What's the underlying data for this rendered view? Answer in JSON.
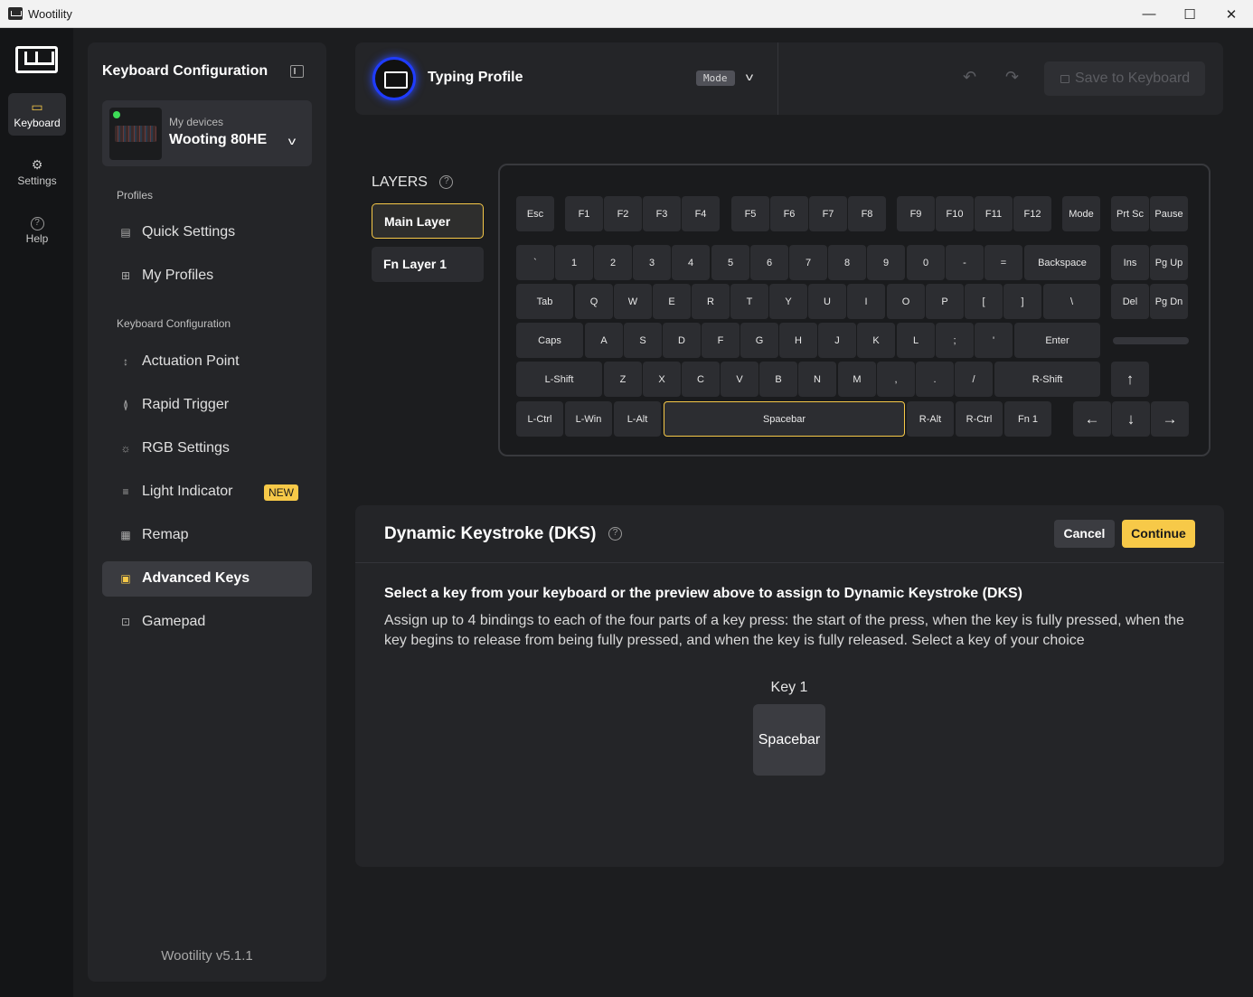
{
  "window": {
    "title": "Wootility",
    "minimize": "—",
    "maximize": "☐",
    "close": "✕"
  },
  "rail": {
    "items": [
      {
        "label": "Keyboard",
        "icon": "keyboard-icon"
      },
      {
        "label": "Settings",
        "icon": "gear-icon"
      },
      {
        "label": "Help",
        "icon": "help-icon"
      }
    ]
  },
  "sidebar": {
    "title": "Keyboard Configuration",
    "device": {
      "label": "My devices",
      "name": "Wooting 80HE",
      "status_color": "#3ddc57"
    },
    "profiles_label": "Profiles",
    "profile_items": [
      "Quick Settings",
      "My Profiles"
    ],
    "config_label": "Keyboard Configuration",
    "config_items": [
      "Actuation Point",
      "Rapid Trigger",
      "RGB Settings",
      "Light Indicator",
      "Remap",
      "Advanced Keys",
      "Gamepad"
    ],
    "new_badge": "NEW",
    "version": "Wootility v5.1.1"
  },
  "topbar": {
    "profile_name": "Typing Profile",
    "mode_badge": "Mode",
    "save_label": "Save to Keyboard"
  },
  "layers": {
    "title": "LAYERS",
    "items": [
      "Main Layer",
      "Fn Layer 1"
    ]
  },
  "keyboard": {
    "rows": [
      [
        "Esc",
        "F1",
        "F2",
        "F3",
        "F4",
        "F5",
        "F6",
        "F7",
        "F8",
        "F9",
        "F10",
        "F11",
        "F12",
        "Mode",
        "Prt Sc",
        "Pause"
      ],
      [
        "`",
        "1",
        "2",
        "3",
        "4",
        "5",
        "6",
        "7",
        "8",
        "9",
        "0",
        "-",
        "=",
        "Backspace",
        "Ins",
        "Pg Up"
      ],
      [
        "Tab",
        "Q",
        "W",
        "E",
        "R",
        "T",
        "Y",
        "U",
        "I",
        "O",
        "P",
        "[",
        "]",
        "\\",
        "Del",
        "Pg Dn"
      ],
      [
        "Caps",
        "A",
        "S",
        "D",
        "F",
        "G",
        "H",
        "J",
        "K",
        "L",
        ";",
        "'",
        "Enter"
      ],
      [
        "L-Shift",
        "Z",
        "X",
        "C",
        "V",
        "B",
        "N",
        "M",
        ",",
        ".",
        "/",
        "R-Shift",
        "↑"
      ],
      [
        "L-Ctrl",
        "L-Win",
        "L-Alt",
        "Spacebar",
        "R-Alt",
        "R-Ctrl",
        "Fn 1",
        "←",
        "↓",
        "→"
      ]
    ],
    "selected_key": "Spacebar"
  },
  "dks": {
    "title": "Dynamic Keystroke (DKS)",
    "cancel": "Cancel",
    "continue": "Continue",
    "instruction": "Select a key from your keyboard or the preview above to assign to Dynamic Keystroke (DKS)",
    "description": "Assign up to 4 bindings to each of the four parts of a key press: the start of the press, when the key is fully pressed, when the key begins to release from being fully pressed, and when the key is fully released. Select a key of your choice",
    "key_label": "Key 1",
    "key_value": "Spacebar"
  },
  "colors": {
    "accent": "#f7c948",
    "background": "#1c1d1f",
    "panel": "#242528"
  }
}
